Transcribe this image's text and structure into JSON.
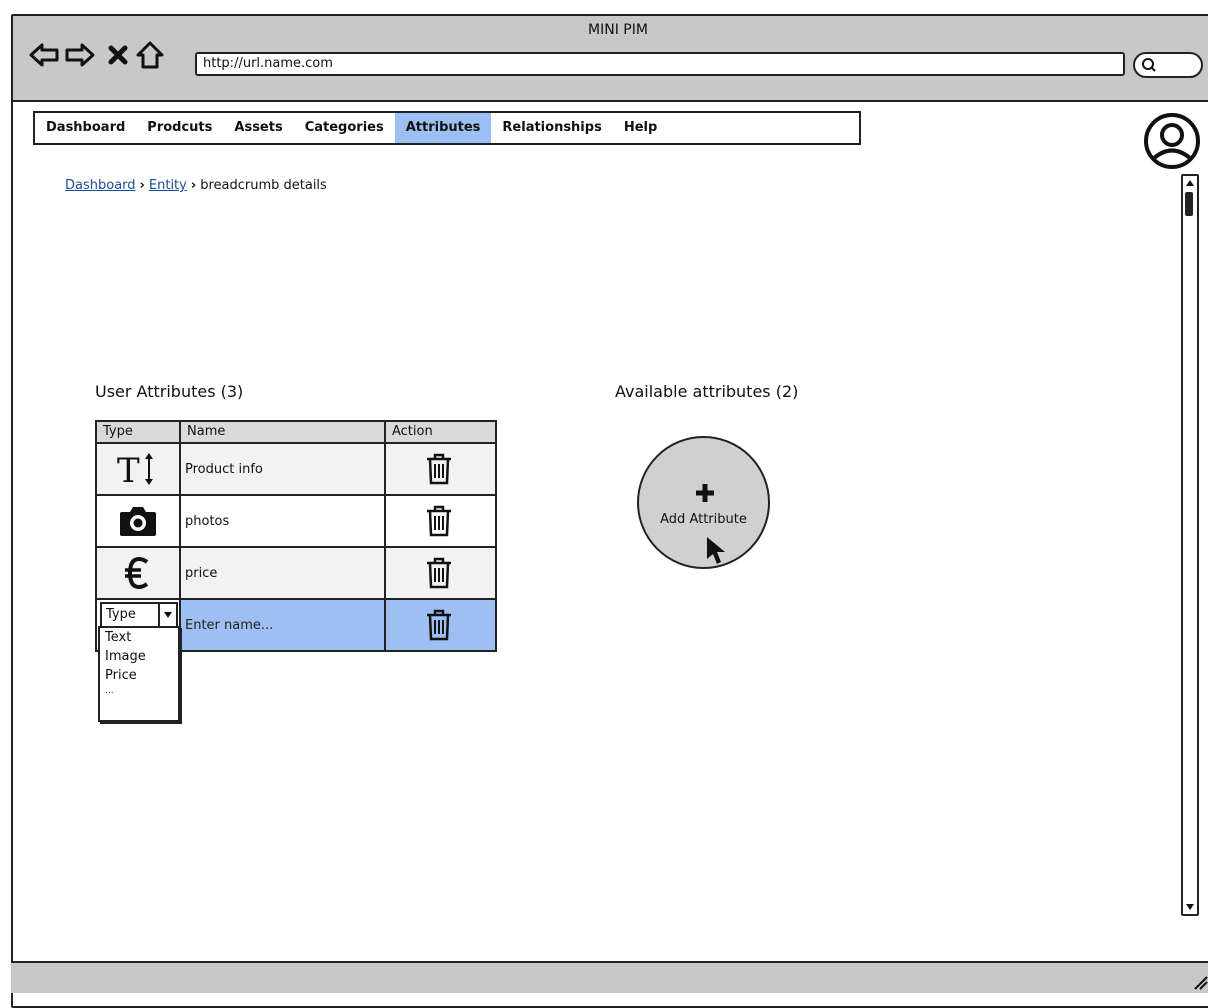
{
  "window": {
    "title": "MINI PIM",
    "url": "http://url.name.com"
  },
  "menu": {
    "items": [
      {
        "label": "Dashboard",
        "active": false
      },
      {
        "label": "Prodcuts",
        "active": false
      },
      {
        "label": "Assets",
        "active": false
      },
      {
        "label": "Categories",
        "active": false
      },
      {
        "label": "Attributes",
        "active": true
      },
      {
        "label": "Relationships",
        "active": false
      },
      {
        "label": "Help",
        "active": false
      }
    ]
  },
  "breadcrumb": {
    "items": [
      "Dashboard",
      "Entity"
    ],
    "current": "breadcrumb details"
  },
  "user_attributes": {
    "title": "User Attributes (3)",
    "columns": [
      "Type",
      "Name",
      "Action"
    ],
    "rows": [
      {
        "type_icon": "text-type-icon",
        "name": "Product info"
      },
      {
        "type_icon": "camera-icon",
        "name": "photos"
      },
      {
        "type_icon": "euro-icon",
        "name": "price"
      }
    ],
    "new_row": {
      "type_value": "Type",
      "name_placeholder": "Enter name..."
    },
    "type_options": [
      "Text",
      "Image",
      "Price",
      "..."
    ]
  },
  "available_attributes": {
    "title": "Available attributes (2)",
    "add_label": "Add Attribute",
    "add_icon": "plus-icon"
  },
  "colors": {
    "selection": "#9ebff2",
    "chrome": "#c8c8c8",
    "link": "#1a4d9c"
  }
}
